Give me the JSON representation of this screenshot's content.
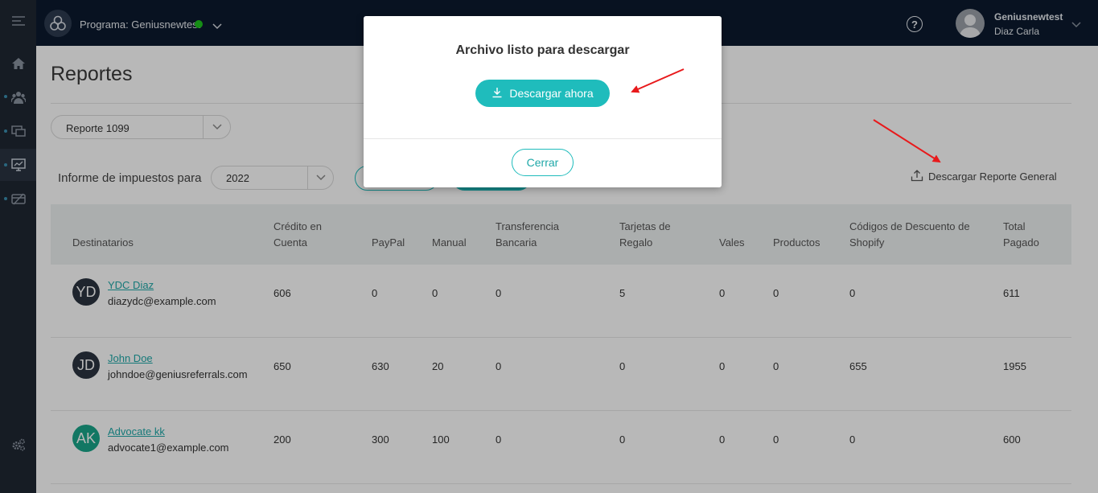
{
  "topbar": {
    "program_label": "Programa: Geniusnewtest",
    "user_name": "Geniusnewtest",
    "user_sub": "Diaz Carla"
  },
  "page": {
    "title": "Reportes",
    "report_select": "Reporte 1099",
    "tax_label": "Informe de impuestos para",
    "year_select": "2022",
    "download_general": "Descargar Reporte General"
  },
  "table": {
    "headers": [
      [
        "Destinatarios"
      ],
      [
        "Crédito en",
        "Cuenta"
      ],
      [
        "PayPal"
      ],
      [
        "Manual"
      ],
      [
        "Transferencia",
        "Bancaria"
      ],
      [
        "Tarjetas de",
        "Regalo"
      ],
      [
        "Vales"
      ],
      [
        "Productos"
      ],
      [
        "Códigos de Descuento de",
        "Shopify"
      ],
      [
        "Total",
        "Pagado"
      ]
    ],
    "rows": [
      {
        "initials": "YD",
        "avatar_color": "#2b3440",
        "name": "YDC Diaz",
        "email": "diazydc@example.com",
        "values": [
          "606",
          "0",
          "0",
          "0",
          "5",
          "0",
          "0",
          "0",
          "611"
        ]
      },
      {
        "initials": "JD",
        "avatar_color": "#2b3440",
        "name": "John Doe",
        "email": "johndoe@geniusreferrals.com",
        "values": [
          "650",
          "630",
          "20",
          "0",
          "0",
          "0",
          "0",
          "655",
          "1955"
        ]
      },
      {
        "initials": "AK",
        "avatar_color": "#1aa589",
        "name": "Advocate kk",
        "email": "advocate1@example.com",
        "values": [
          "200",
          "300",
          "100",
          "0",
          "0",
          "0",
          "0",
          "0",
          "600"
        ]
      }
    ]
  },
  "modal": {
    "title": "Archivo listo para descargar",
    "download_label": "Descargar ahora",
    "close_label": "Cerrar"
  },
  "colors": {
    "accent": "#1fbcbc",
    "topbar": "#0c1a2e",
    "sidebar": "#1f2733",
    "status_online": "#1ec41e",
    "annotation_arrow": "#e8191b"
  }
}
